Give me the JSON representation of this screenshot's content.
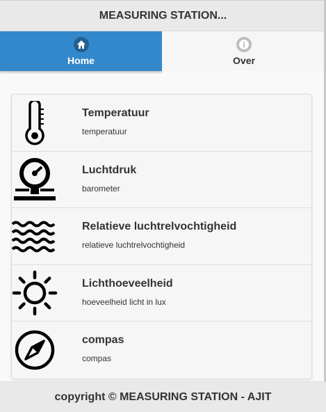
{
  "header": {
    "title": "MEASURING STATION..."
  },
  "navbar": {
    "tabs": [
      {
        "label": "Home",
        "icon": "home-icon",
        "active": true
      },
      {
        "label": "Over",
        "icon": "info-icon",
        "active": false
      }
    ]
  },
  "list": {
    "items": [
      {
        "title": "Temperatuur",
        "subtitle": "temperatuur",
        "icon": "thermometer-icon"
      },
      {
        "title": "Luchtdruk",
        "subtitle": "barometer",
        "icon": "barometer-icon"
      },
      {
        "title": "Relatieve luchtrelvochtigheid",
        "subtitle": "relatieve luchtrelvochtigheid",
        "icon": "waves-icon"
      },
      {
        "title": "Lichthoeveelheid",
        "subtitle": "hoeveelheid licht in lux",
        "icon": "sun-icon"
      },
      {
        "title": "compas",
        "subtitle": "compas",
        "icon": "compass-icon"
      }
    ]
  },
  "footer": {
    "text": "copyright © MEASURING STATION - AJIT"
  },
  "colors": {
    "accent": "#3388cc",
    "bar": "#e9e9e9"
  }
}
